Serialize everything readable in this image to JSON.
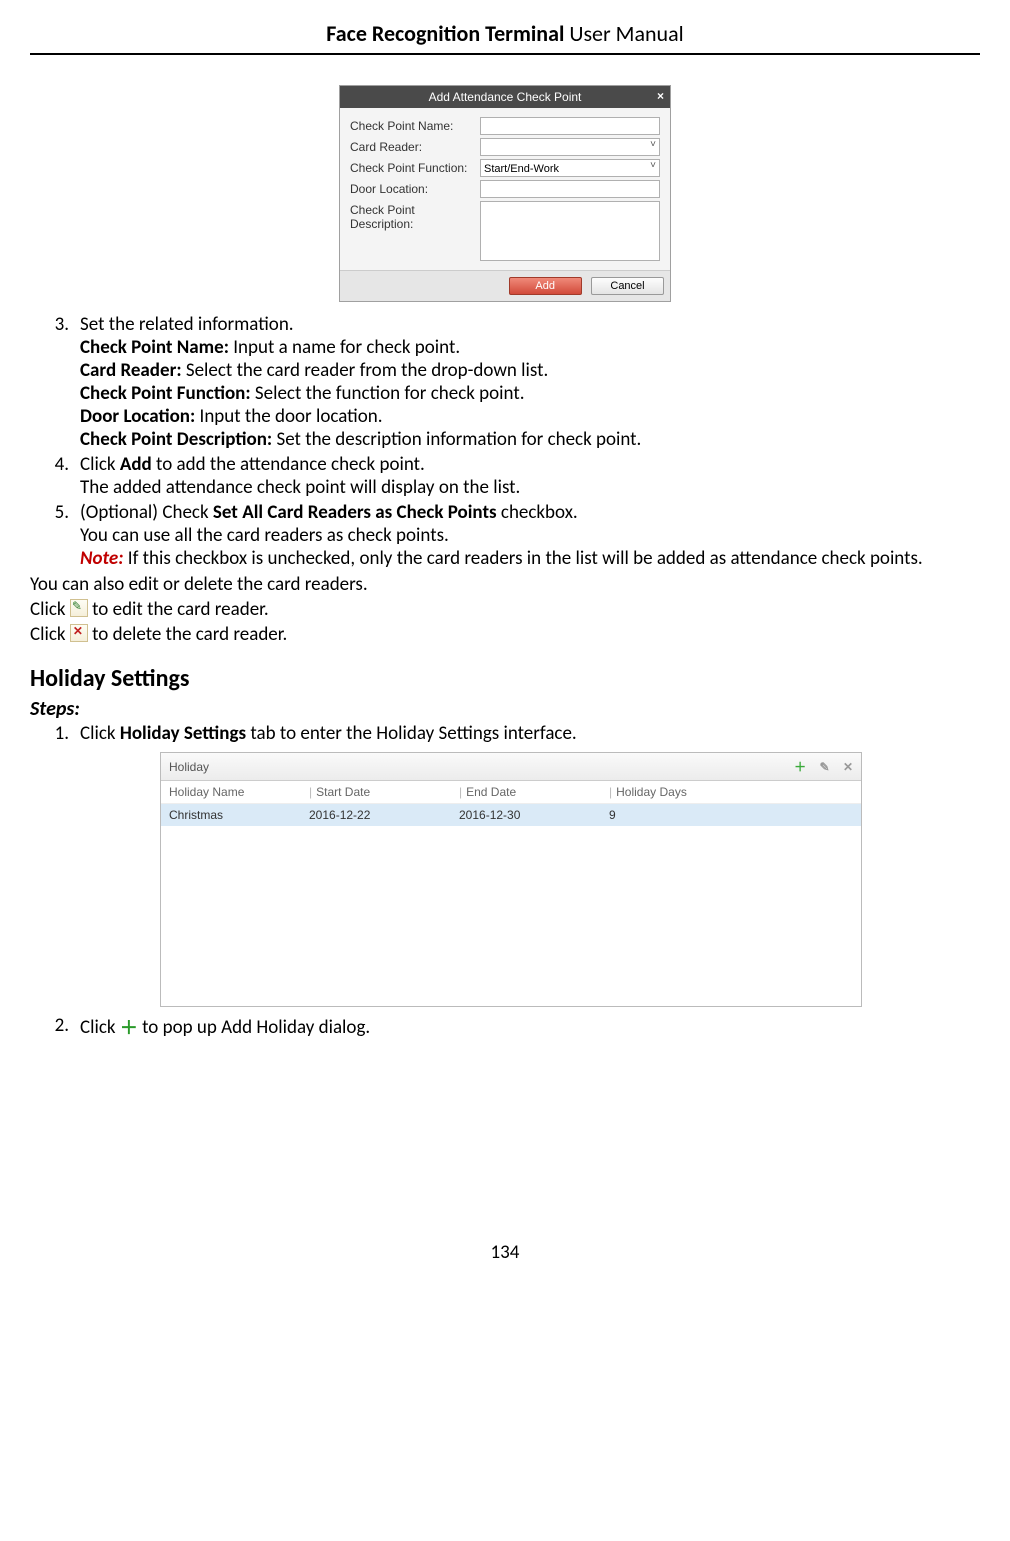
{
  "header": {
    "title_bold": "Face Recognition Terminal",
    "title_light": "  User Manual"
  },
  "dialog": {
    "title": "Add Attendance Check Point",
    "labels": {
      "name": "Check Point Name:",
      "reader": "Card Reader:",
      "func": "Check Point Function:",
      "door": "Door Location:",
      "desc": "Check Point Description:"
    },
    "func_value": "Start/End-Work",
    "add_btn": "Add",
    "cancel_btn": "Cancel"
  },
  "steps3": {
    "num": "3.",
    "lead": "Set the related information.",
    "name_b": "Check Point Name:",
    "name_t": " Input a name for check point.",
    "reader_b": "Card Reader:",
    "reader_t": " Select the card reader from the drop-down list.",
    "func_b": "Check Point Function:",
    "func_t": " Select the function for check point.",
    "door_b": "Door Location:",
    "door_t": " Input the door location.",
    "desc_b": "Check Point Description:",
    "desc_t": " Set the description information for check point."
  },
  "steps4": {
    "num": "4.",
    "t1a": "Click ",
    "t1b": "Add",
    "t1c": " to add the attendance check point.",
    "t2": "The added attendance check point will display on the list."
  },
  "steps5": {
    "num": "5.",
    "t1a": "(Optional) Check ",
    "t1b": "Set All Card Readers as Check Points",
    "t1c": " checkbox.",
    "t2": "You can use all the card readers as check points.",
    "note_label": "Note:",
    "note_text": " If this checkbox is unchecked, only the card readers in the list will be added as attendance check points."
  },
  "lower": {
    "l1": "You can also edit or delete the card readers.",
    "l2a": "Click ",
    "l2b": " to edit the card reader.",
    "l3a": "Click ",
    "l3b": " to delete the card reader."
  },
  "holiday_heading": "Holiday Settings",
  "steps_label": "Steps:",
  "hstep1": {
    "num": "1.",
    "a": "Click ",
    "b": "Holiday Settings",
    "c": " tab to enter the Holiday Settings interface."
  },
  "holiday_panel": {
    "title": "Holiday",
    "cols": {
      "c1": "Holiday Name",
      "c2": "Start Date",
      "c3": "End Date",
      "c4": "Holiday Days"
    },
    "row": {
      "c1": "Christmas",
      "c2": "2016-12-22",
      "c3": "2016-12-30",
      "c4": "9"
    }
  },
  "hstep2": {
    "num": "2.",
    "a": "Click ",
    "b": " to pop up Add Holiday dialog."
  },
  "page_number": "134"
}
